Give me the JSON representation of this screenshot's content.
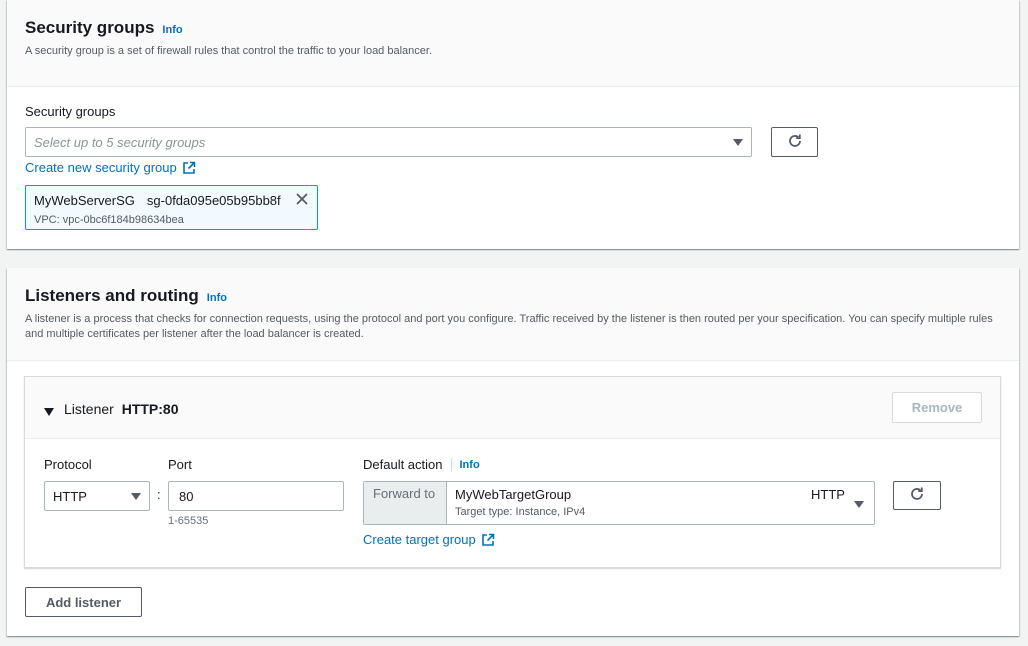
{
  "security_groups_section": {
    "title": "Security groups",
    "info": "Info",
    "description": "A security group is a set of firewall rules that control the traffic to your load balancer.",
    "field_label": "Security groups",
    "select_placeholder": "Select up to 5 security groups",
    "create_link": "Create new security group",
    "selected": {
      "name": "MyWebServerSG",
      "id": "sg-0fda095e05b95bb8f",
      "vpc": "VPC: vpc-0bc6f184b98634bea"
    }
  },
  "listeners_section": {
    "title": "Listeners and routing",
    "info": "Info",
    "description": "A listener is a process that checks for connection requests, using the protocol and port you configure. Traffic received by the listener is then routed per your specification. You can specify multiple rules and multiple certificates per listener after the load balancer is created.",
    "listener": {
      "label": "Listener",
      "name": "HTTP:80",
      "remove_label": "Remove",
      "protocol_label": "Protocol",
      "protocol_value": "HTTP",
      "separator": ":",
      "port_label": "Port",
      "port_value": "80",
      "port_hint": "1-65535",
      "default_action_label": "Default action",
      "default_action_info": "Info",
      "forward_to_label": "Forward to",
      "target_group_name": "MyWebTargetGroup",
      "target_group_protocol": "HTTP",
      "target_group_detail": "Target type: Instance, IPv4",
      "create_target_group_link": "Create target group"
    },
    "add_listener_label": "Add listener"
  },
  "colors": {
    "link": "#0073bb",
    "token_border": "#00a1c9",
    "background": "#f2f3f3"
  }
}
